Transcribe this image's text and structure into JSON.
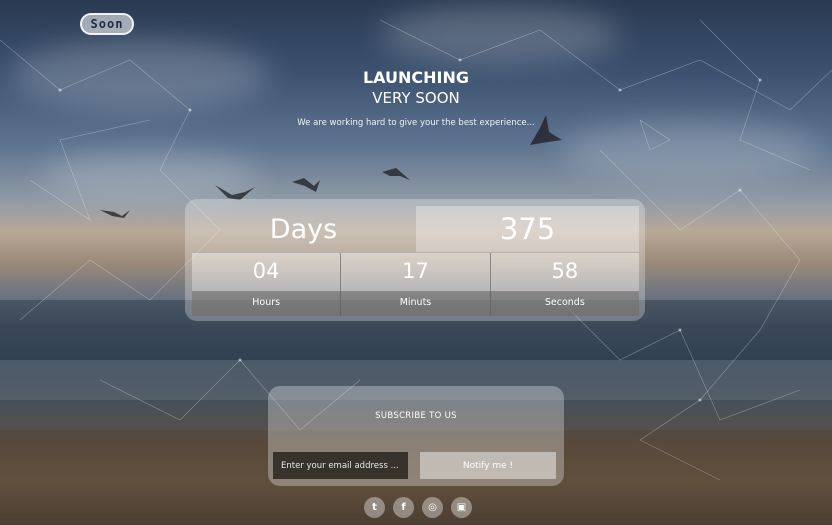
{
  "logo": {
    "text": "Soon"
  },
  "header": {
    "title": "LAUNCHING",
    "subtitle": "VERY SOON",
    "tagline": "We are working hard to give your the best experience..."
  },
  "countdown": {
    "days_label": "Days",
    "days_value": "375",
    "units": [
      {
        "value": "04",
        "label": "Hours"
      },
      {
        "value": "17",
        "label": "Minuts"
      },
      {
        "value": "58",
        "label": "Seconds"
      }
    ]
  },
  "subscribe": {
    "title": "SUBSCRIBE TO US",
    "email_placeholder": "Enter your email address ...",
    "button_label": "Notify me !"
  },
  "social": [
    {
      "icon": "twitter-icon",
      "glyph": "t"
    },
    {
      "icon": "facebook-icon",
      "glyph": "f"
    },
    {
      "icon": "dribbble-icon",
      "glyph": "◎"
    },
    {
      "icon": "instagram-icon",
      "glyph": "▣"
    }
  ]
}
